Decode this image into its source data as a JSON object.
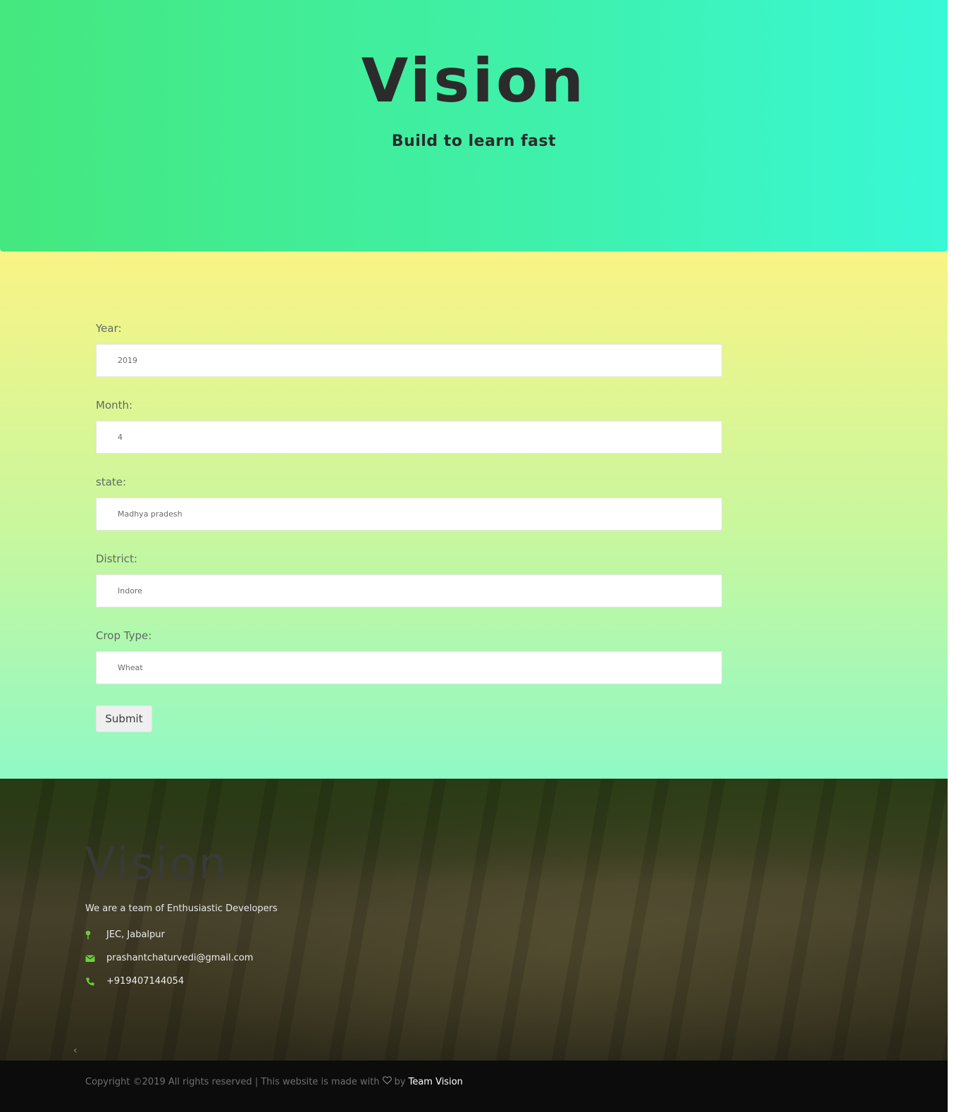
{
  "hero": {
    "title": "Vision",
    "subtitle": "Build to learn fast"
  },
  "form": {
    "fields": [
      {
        "label": "Year:",
        "value": "2019"
      },
      {
        "label": "Month:",
        "value": "4"
      },
      {
        "label": "state:",
        "value": "Madhya pradesh"
      },
      {
        "label": "District:",
        "value": "Indore"
      },
      {
        "label": "Crop Type:",
        "value": "Wheat"
      }
    ],
    "submit_label": "Submit"
  },
  "footer": {
    "title": "Vision",
    "tagline": "We are a team of Enthusiastic Developers",
    "contacts": [
      {
        "icon": "map-pin-icon",
        "text": "JEC, Jabalpur"
      },
      {
        "icon": "envelope-icon",
        "text": "prashantchaturvedi@gmail.com"
      },
      {
        "icon": "phone-icon",
        "text": "+919407144054"
      }
    ],
    "prev_arrow": "‹",
    "copyright_prefix": "Copyright ©2019 All rights reserved | This website is made with",
    "copyright_by": "by",
    "team_link": "Team Vision"
  },
  "colors": {
    "hero_gradient_start": "#45e87e",
    "hero_gradient_end": "#38f8d6",
    "form_gradient_top": "#f9f485",
    "form_gradient_bottom": "#8ff9c6",
    "icon_green": "#6bd23a",
    "bottom_bar": "#0c0c0c"
  }
}
